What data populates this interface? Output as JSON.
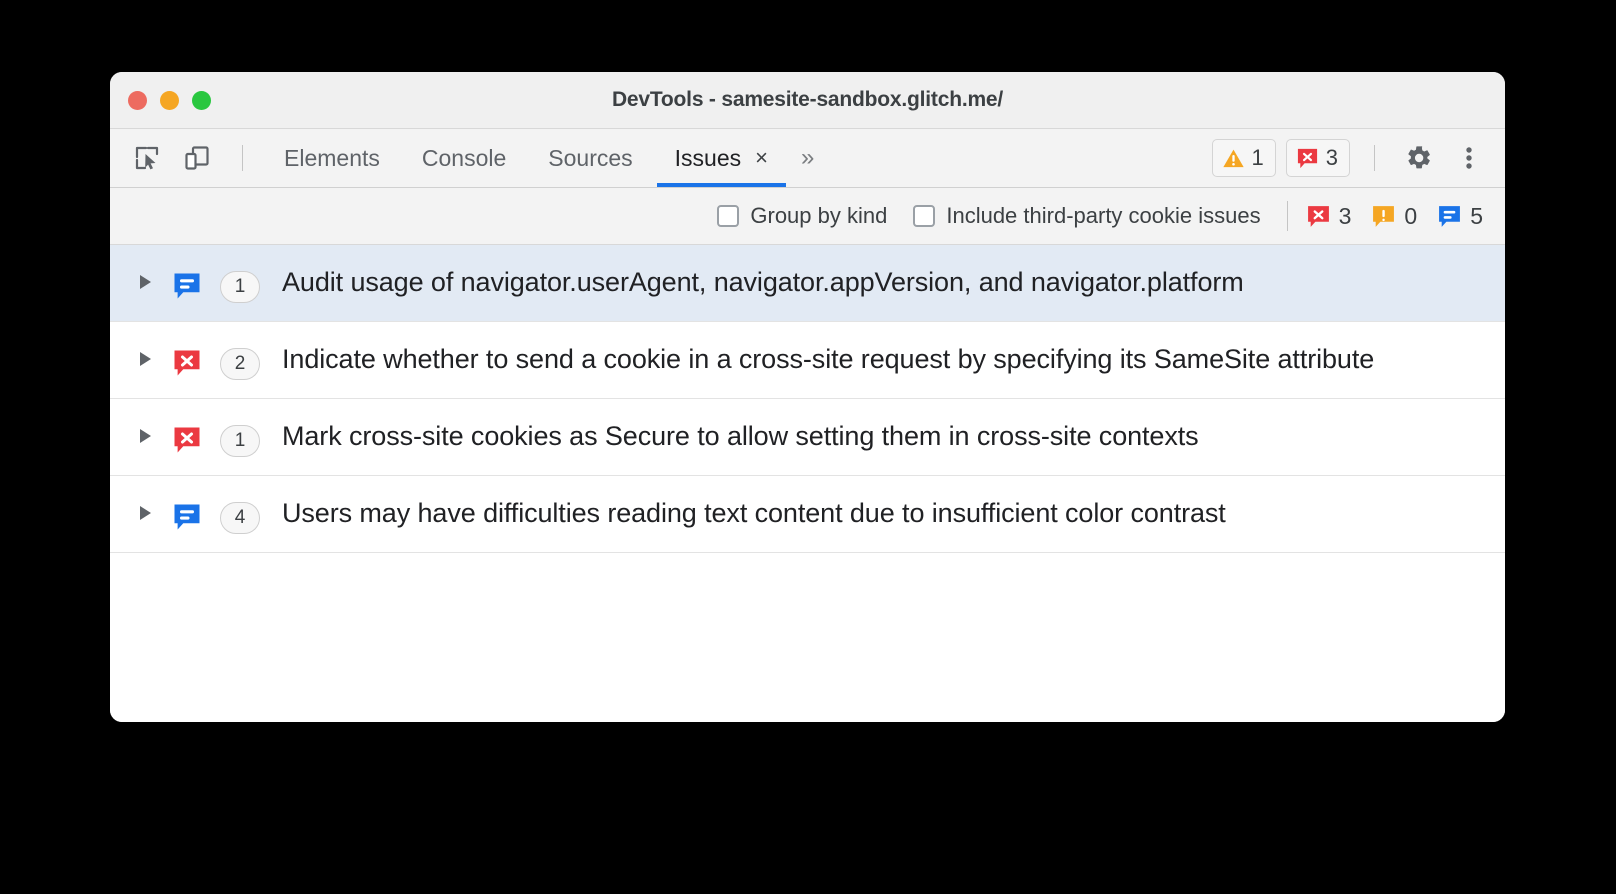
{
  "window": {
    "title": "DevTools - samesite-sandbox.glitch.me/",
    "traffic_lights": [
      {
        "name": "close",
        "color": "#ed6b60"
      },
      {
        "name": "minimize",
        "color": "#f5a623"
      },
      {
        "name": "maximize",
        "color": "#29c73f"
      }
    ]
  },
  "toolbar": {
    "inspect_icon": "inspect-element-icon",
    "device_icon": "device-toolbar-icon",
    "settings_icon": "gear-icon",
    "menu_icon": "more-vertical-icon"
  },
  "tabs": [
    {
      "label": "Elements",
      "active": false
    },
    {
      "label": "Console",
      "active": false
    },
    {
      "label": "Sources",
      "active": false
    },
    {
      "label": "Issues",
      "active": true,
      "close_label": "×"
    }
  ],
  "more_tabs_label": "»",
  "tabbar_counts": [
    {
      "icon": "warning-icon",
      "value": "1",
      "color": "#f29900"
    },
    {
      "icon": "error-icon",
      "value": "3",
      "color": "#eb3941"
    }
  ],
  "filters": {
    "checkboxes": [
      {
        "label": "Group by kind",
        "checked": false
      },
      {
        "label": "Include third-party cookie issues",
        "checked": false
      }
    ],
    "counts": [
      {
        "icon": "error-icon",
        "value": "3",
        "color": "#eb3941"
      },
      {
        "icon": "warning-icon",
        "value": "0",
        "color": "#f5a623"
      },
      {
        "icon": "info-icon",
        "value": "5",
        "color": "#1a73e8"
      }
    ]
  },
  "issues": [
    {
      "kind": "info",
      "count": "1",
      "title": "Audit usage of navigator.userAgent, navigator.appVersion, and navigator.platform",
      "selected": true
    },
    {
      "kind": "error",
      "count": "2",
      "title": "Indicate whether to send a cookie in a cross-site request by specifying its SameSite attribute",
      "selected": false
    },
    {
      "kind": "error",
      "count": "1",
      "title": "Mark cross-site cookies as Secure to allow setting them in cross-site contexts",
      "selected": false
    },
    {
      "kind": "info",
      "count": "4",
      "title": "Users may have difficulties reading text content due to insufficient color contrast",
      "selected": false
    }
  ],
  "colors": {
    "accent_blue": "#1a73e8",
    "error_red": "#eb3941",
    "warning_orange": "#f5a623",
    "selected_row": "#e2eaf4"
  }
}
